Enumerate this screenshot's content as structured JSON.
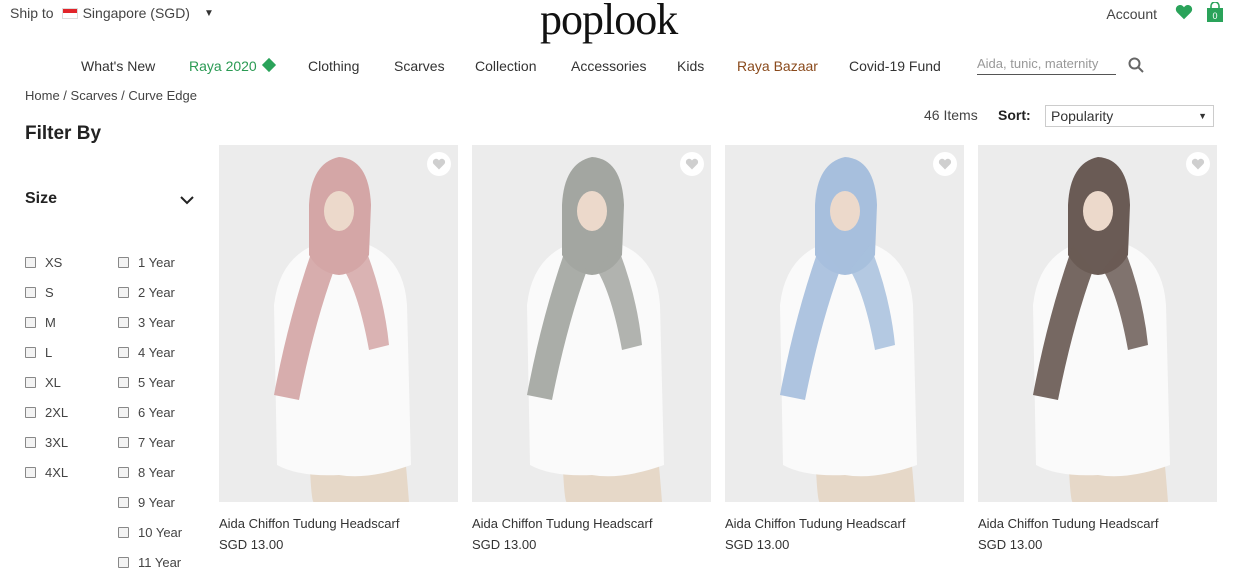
{
  "header": {
    "ship_label": "Ship to",
    "country": "Singapore (SGD)",
    "logo": "poplook",
    "account": "Account",
    "cart_count": "0",
    "brand_green": "#2aa35a"
  },
  "nav": {
    "items": [
      "What's New",
      "Raya 2020",
      "Clothing",
      "Scarves",
      "Collection",
      "Accessories",
      "Kids",
      "Raya Bazaar",
      "Covid-19 Fund"
    ],
    "search_placeholder": "Aida, tunic, maternity"
  },
  "breadcrumb": [
    "Home",
    "Scarves",
    "Curve Edge"
  ],
  "filter": {
    "title": "Filter By",
    "size_heading": "Size",
    "sizes_left": [
      "XS",
      "S",
      "M",
      "L",
      "XL",
      "2XL",
      "3XL",
      "4XL"
    ],
    "sizes_right": [
      "1 Year",
      "2 Year",
      "3 Year",
      "4 Year",
      "5 Year",
      "6 Year",
      "7 Year",
      "8 Year",
      "9 Year",
      "10 Year",
      "11 Year"
    ]
  },
  "listing": {
    "count": "46 Items",
    "sort_label": "Sort:",
    "sort_value": "Popularity"
  },
  "products": [
    {
      "name": "Aida Chiffon Tudung Headscarf",
      "price": "SGD 13.00",
      "scarf_color": "#d4a6a6"
    },
    {
      "name": "Aida Chiffon Tudung Headscarf",
      "price": "SGD 13.00",
      "scarf_color": "#a3a6a1"
    },
    {
      "name": "Aida Chiffon Tudung Headscarf",
      "price": "SGD 13.00",
      "scarf_color": "#a7bfdd"
    },
    {
      "name": "Aida Chiffon Tudung Headscarf",
      "price": "SGD 13.00",
      "scarf_color": "#6a5b55"
    }
  ]
}
